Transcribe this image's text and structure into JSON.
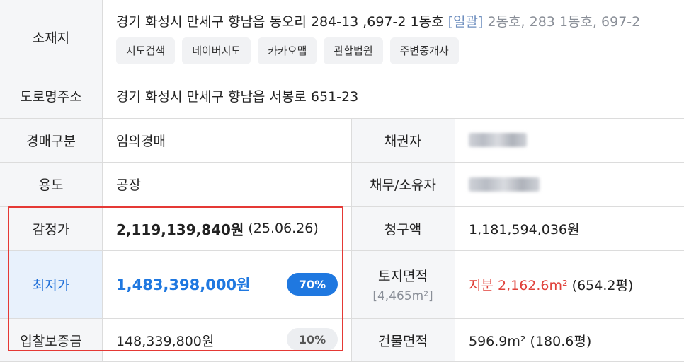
{
  "rows": {
    "location": {
      "label": "소재지",
      "address_main": "경기 화성시 만세구 향남읍 동오리 284-13 ,697-2 1동호",
      "address_tag": "[일괄]",
      "address_rest": "2동호, 283 1동호, 697-2",
      "chips": [
        "지도검색",
        "네이버지도",
        "카카오맵",
        "관할법원",
        "주변중개사"
      ]
    },
    "road_address": {
      "label": "도로명주소",
      "value": "경기 화성시 만세구 향남읍 서봉로 651-23"
    },
    "auction_type": {
      "label": "경매구분",
      "value": "임의경매"
    },
    "creditor": {
      "label": "채권자"
    },
    "usage": {
      "label": "용도",
      "value": "공장"
    },
    "debtor_owner": {
      "label": "채무/소유자"
    },
    "appraisal": {
      "label": "감정가",
      "amount": "2,119,139,840원",
      "date": "(25.06.26)"
    },
    "claim_amount": {
      "label": "청구액",
      "value": "1,181,594,036원"
    },
    "minimum_price": {
      "label": "최저가",
      "amount": "1,483,398,000원",
      "percent": "70%"
    },
    "land_area": {
      "label": "토지면적",
      "label_sub": "[4,465m²]",
      "value_share": "지분 2,162.6m²",
      "value_pyeong": "(654.2평)"
    },
    "deposit": {
      "label": "입찰보증금",
      "amount": "148,339,800원",
      "percent": "10%"
    },
    "building_area": {
      "label": "건물면적",
      "value": "596.9m² (180.6평)"
    }
  },
  "colors": {
    "label_bg": "#f5f6f8",
    "highlight_bg": "#e8f1fc",
    "accent_blue": "#1f78e0",
    "accent_red": "#e0413a",
    "highlight_box": "#e53935"
  }
}
